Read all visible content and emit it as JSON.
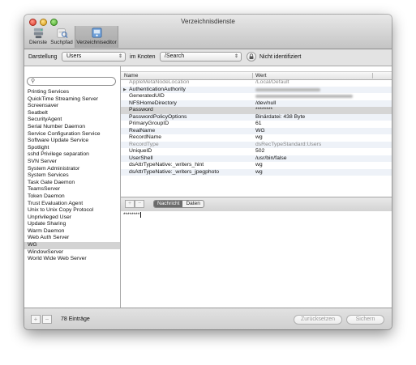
{
  "window": {
    "title": "Verzeichnisdienste"
  },
  "toolbar": {
    "items": [
      {
        "label": "Dienste"
      },
      {
        "label": "Suchpfad"
      },
      {
        "label": "Verzeichniseditor"
      }
    ]
  },
  "scope": {
    "display_label": "Darstellung",
    "display_value": "Users",
    "node_label": "im Knoten",
    "node_value": "/Search",
    "auth_status": "Nicht identifiziert"
  },
  "sidebar": {
    "items": [
      "Printing Services",
      "QuickTime Streaming Server",
      "Screensaver",
      "Seatbelt",
      "SecurityAgent",
      "Serial Number Daemon",
      "Service Configuration Service",
      "Software Update Service",
      "Spotlight",
      "sshd Privilege separation",
      "SVN Server",
      "System Administrator",
      "System Services",
      "Task Gate Daemon",
      "TeamsServer",
      "Token Daemon",
      "Trust Evaluation Agent",
      "Unix to Unix Copy Protocol",
      "Unprivileged User",
      "Update Sharing",
      "Warm Daemon",
      "Web Auth Server",
      "WG",
      "WindowServer",
      "World Wide Web Server"
    ],
    "count_label": "78 Einträge"
  },
  "table": {
    "columns": {
      "name": "Name",
      "value": "Wert"
    },
    "rows": [
      {
        "name": "AppleMetaNodeLocation",
        "value": "/Local/Default"
      },
      {
        "name": "AuthenticationAuthority",
        "value": ""
      },
      {
        "name": "GeneratedUID",
        "value": ""
      },
      {
        "name": "NFSHomeDirectory",
        "value": "/dev/null"
      },
      {
        "name": "Password",
        "value": "********"
      },
      {
        "name": "PasswordPolicyOptions",
        "value": "Binärdatei: 438 Byte"
      },
      {
        "name": "PrimaryGroupID",
        "value": "61"
      },
      {
        "name": "RealName",
        "value": "WG"
      },
      {
        "name": "RecordName",
        "value": "wg"
      },
      {
        "name": "RecordType",
        "value": "dsRecTypeStandard:Users"
      },
      {
        "name": "UniqueID",
        "value": "502"
      },
      {
        "name": "UserShell",
        "value": "/usr/bin/false"
      },
      {
        "name": "dsAttrTypeNative:_writers_hint",
        "value": "wg"
      },
      {
        "name": "dsAttrTypeNative:_writers_jpegphoto",
        "value": "wg"
      }
    ]
  },
  "detail": {
    "tab_message": "Nachricht",
    "tab_data": "Daten",
    "content": "********"
  },
  "buttons": {
    "plus": "+",
    "minus": "−",
    "revert": "Zurücksetzen",
    "save": "Sichern"
  }
}
